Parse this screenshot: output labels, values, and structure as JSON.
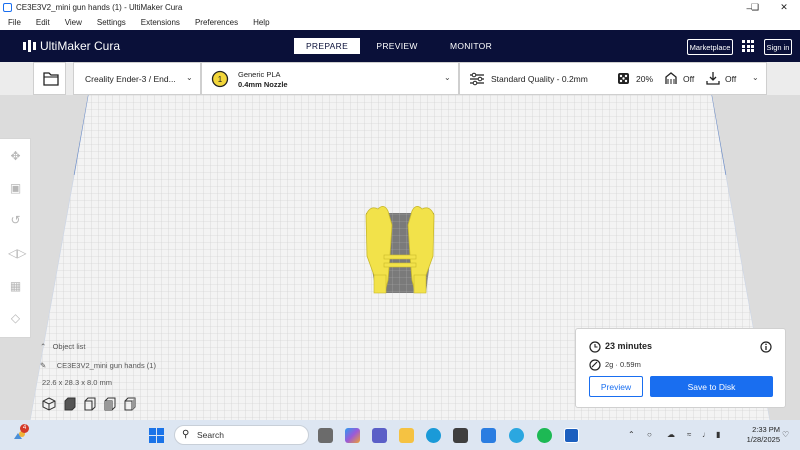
{
  "window": {
    "title": "CE3E3V2_mini gun hands (1) - UltiMaker Cura",
    "controls": [
      "minimize",
      "restore",
      "close"
    ]
  },
  "menu": [
    "File",
    "Edit",
    "View",
    "Settings",
    "Extensions",
    "Preferences",
    "Help"
  ],
  "header": {
    "brand": "UltiMaker Cura",
    "stages": [
      {
        "label": "PREPARE",
        "active": true
      },
      {
        "label": "PREVIEW",
        "active": false
      },
      {
        "label": "MONITOR",
        "active": false
      }
    ],
    "marketplace": "Marketplace",
    "signin": "Sign in"
  },
  "setup": {
    "printer": "Creality Ender-3 / End...",
    "material_index": "1",
    "material": "Generic PLA",
    "nozzle": "0.4mm Nozzle",
    "quality": "Standard Quality - 0.2mm",
    "infill": "20%",
    "support": "Off",
    "adhesion": "Off"
  },
  "objects": {
    "header": "Object list",
    "item": "CE3E3V2_mini gun hands (1)",
    "dimensions": "22.6 x 28.3 x 8.0 mm"
  },
  "print": {
    "time": "23 minutes",
    "material": "2g · 0.59m",
    "preview_label": "Preview",
    "save_label": "Save to Disk"
  },
  "taskbar": {
    "search": "Search",
    "notification_count": "4",
    "time": "2:33 PM",
    "date": "1/28/2025"
  },
  "colors": {
    "header_bg": "#0a1039",
    "accent": "#196ef0",
    "model": "#f2e24a"
  }
}
